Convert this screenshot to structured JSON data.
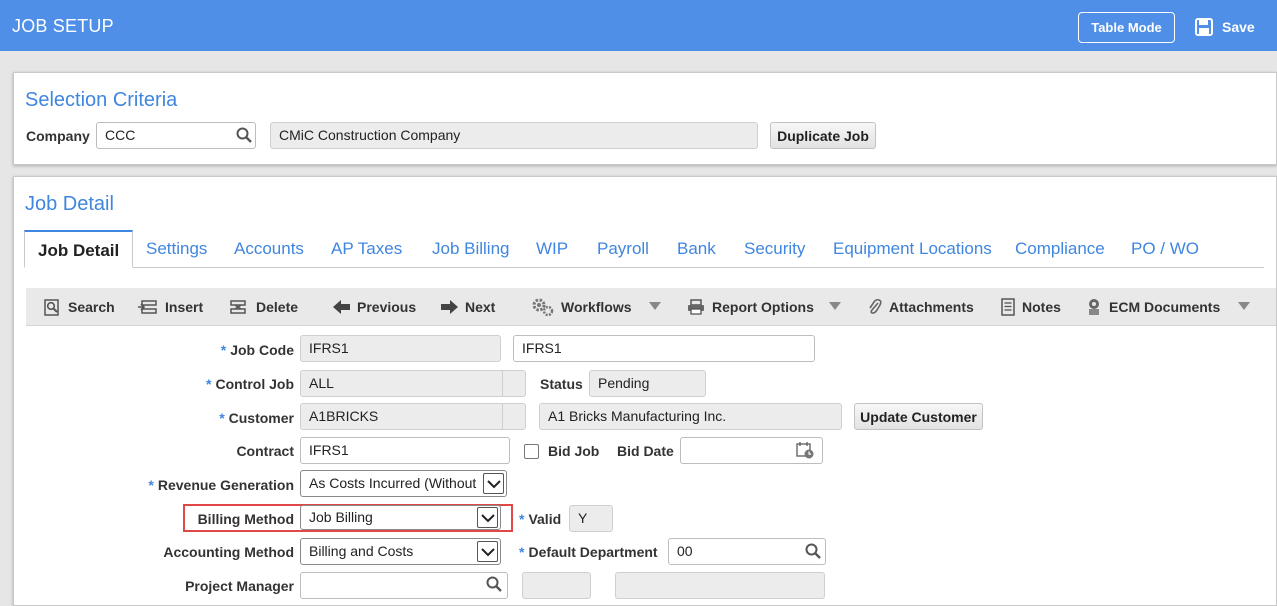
{
  "header": {
    "title": "JOB SETUP",
    "table_mode_label": "Table Mode",
    "save_label": "Save"
  },
  "selection_criteria": {
    "title": "Selection Criteria",
    "company_label": "Company",
    "company_value": "CCC",
    "company_name": "CMiC Construction Company",
    "duplicate_job_label": "Duplicate Job"
  },
  "job_detail": {
    "title": "Job Detail",
    "tabs": [
      {
        "label": "Job Detail"
      },
      {
        "label": "Settings"
      },
      {
        "label": "Accounts"
      },
      {
        "label": "AP Taxes"
      },
      {
        "label": "Job Billing"
      },
      {
        "label": "WIP"
      },
      {
        "label": "Payroll"
      },
      {
        "label": "Bank"
      },
      {
        "label": "Security"
      },
      {
        "label": "Equipment Locations"
      },
      {
        "label": "Compliance"
      },
      {
        "label": "PO / WO"
      }
    ],
    "active_tab": "Job Detail",
    "toolbar": {
      "search": "Search",
      "insert": "Insert",
      "delete": "Delete",
      "previous": "Previous",
      "next": "Next",
      "workflows": "Workflows",
      "report_options": "Report Options",
      "attachments": "Attachments",
      "notes": "Notes",
      "ecm_documents": "ECM Documents"
    },
    "form": {
      "required_marker": "*",
      "job_code_label": "Job Code",
      "job_code_value": "IFRS1",
      "job_name_value": "IFRS1",
      "control_job_label": "Control Job",
      "control_job_value": "ALL",
      "status_label": "Status",
      "status_value": "Pending",
      "customer_label": "Customer",
      "customer_value": "A1BRICKS",
      "customer_name": "A1 Bricks Manufacturing Inc.",
      "update_customer_label": "Update Customer",
      "contract_label": "Contract",
      "contract_value": "IFRS1",
      "bid_job_label": "Bid Job",
      "bid_date_label": "Bid Date",
      "bid_date_value": "",
      "revenue_generation_label": "Revenue Generation",
      "revenue_generation_value": "As Costs Incurred (Without",
      "billing_method_label": "Billing Method",
      "billing_method_value": "Job Billing",
      "valid_label": "Valid",
      "valid_value": "Y",
      "accounting_method_label": "Accounting Method",
      "accounting_method_value": "Billing and Costs",
      "default_department_label": "Default Department",
      "default_department_value": "00",
      "project_manager_label": "Project Manager",
      "project_manager_value": ""
    }
  },
  "colors": {
    "header_bg": "#4f8fe8",
    "accent": "#3f86e0",
    "highlight": "#e04848"
  }
}
